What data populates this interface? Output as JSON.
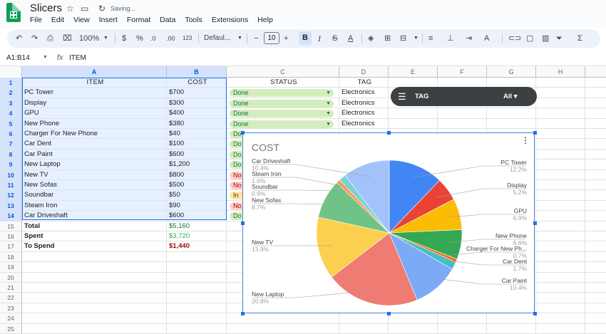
{
  "app": {
    "doc_title": "Slicers",
    "saving": "Saving...",
    "menu": [
      "File",
      "Edit",
      "View",
      "Insert",
      "Format",
      "Data",
      "Tools",
      "Extensions",
      "Help"
    ]
  },
  "toolbar": {
    "zoom": "100%",
    "currency": "$",
    "percent": "%",
    "dec_decrease": ".0",
    "dec_increase": ".00",
    "format_num": "123",
    "font": "Defaul...",
    "font_size": "10",
    "minus": "−",
    "plus": "+",
    "bold": "B",
    "italic": "I",
    "sum": "Σ"
  },
  "formula": {
    "name_box": "A1:B14",
    "fx": "fx",
    "value": "ITEM"
  },
  "columns": [
    "A",
    "B",
    "C",
    "D",
    "E",
    "F",
    "G",
    "H"
  ],
  "rows": [
    "1",
    "2",
    "3",
    "4",
    "5",
    "6",
    "7",
    "8",
    "9",
    "10",
    "11",
    "12",
    "13",
    "14",
    "15",
    "16",
    "17",
    "18",
    "19",
    "20",
    "21",
    "22",
    "23",
    "24",
    "25"
  ],
  "headers": {
    "item": "ITEM",
    "cost": "COST",
    "status": "STATUS",
    "tag": "TAG"
  },
  "table": [
    {
      "item": "PC Tower",
      "cost": "$700",
      "status": "Done",
      "s": "done",
      "tag": "Electronics"
    },
    {
      "item": "Display",
      "cost": "$300",
      "status": "Done",
      "s": "done",
      "tag": "Electronics"
    },
    {
      "item": "GPU",
      "cost": "$400",
      "status": "Done",
      "s": "done",
      "tag": "Electronics"
    },
    {
      "item": "New Phone",
      "cost": "$380",
      "status": "Done",
      "s": "done",
      "tag": "Electronics"
    },
    {
      "item": "Charger For New Phone",
      "cost": "$40",
      "status": "Do",
      "s": "done",
      "tag": ""
    },
    {
      "item": "Car Dent",
      "cost": "$100",
      "status": "Do",
      "s": "done",
      "tag": ""
    },
    {
      "item": "Car Paint",
      "cost": "$600",
      "status": "Do",
      "s": "done",
      "tag": ""
    },
    {
      "item": "New Laptop",
      "cost": "$1,200",
      "status": "Do",
      "s": "done",
      "tag": ""
    },
    {
      "item": "New TV",
      "cost": "$800",
      "status": "No",
      "s": "no",
      "tag": ""
    },
    {
      "item": "New Sofas",
      "cost": "$500",
      "status": "No",
      "s": "no",
      "tag": ""
    },
    {
      "item": "Soundbar",
      "cost": "$50",
      "status": "In",
      "s": "in",
      "tag": ""
    },
    {
      "item": "Steam Iron",
      "cost": "$90",
      "status": "No",
      "s": "no",
      "tag": ""
    },
    {
      "item": "Car Driveshaft",
      "cost": "$600",
      "status": "Do",
      "s": "done",
      "tag": ""
    }
  ],
  "summary": [
    {
      "label": "Total",
      "value": "$5,160",
      "color": "#137333"
    },
    {
      "label": "Spent",
      "value": "$3,720",
      "color": "#34a853"
    },
    {
      "label": "To Spend",
      "value": "$1,440",
      "color": "#a50e0e"
    }
  ],
  "slicer": {
    "column": "TAG",
    "value": "All ▾"
  },
  "chart_data": {
    "type": "pie",
    "title": "COST",
    "slices": [
      {
        "label": "PC Tower",
        "value": 700,
        "pct": "12.2%",
        "color": "#4285f4"
      },
      {
        "label": "Display",
        "value": 300,
        "pct": "5.2%",
        "color": "#ea4335"
      },
      {
        "label": "GPU",
        "value": 400,
        "pct": "6.9%",
        "color": "#fbbc04"
      },
      {
        "label": "New Phone",
        "value": 380,
        "pct": "6.6%",
        "color": "#34a853"
      },
      {
        "label": "Charger For New Ph...",
        "value": 40,
        "pct": "0.7%",
        "color": "#ff6d01"
      },
      {
        "label": "Car Dent",
        "value": 100,
        "pct": "1.7%",
        "color": "#46bdc6"
      },
      {
        "label": "Car Paint",
        "value": 600,
        "pct": "10.4%",
        "color": "#7baaf7"
      },
      {
        "label": "New Laptop",
        "value": 1200,
        "pct": "20.8%",
        "color": "#f07b72"
      },
      {
        "label": "New TV",
        "value": 800,
        "pct": "13.9%",
        "color": "#fcd04f"
      },
      {
        "label": "New Sofas",
        "value": 500,
        "pct": "8.7%",
        "color": "#71c287"
      },
      {
        "label": "Soundbar",
        "value": 50,
        "pct": "0.9%",
        "color": "#ff994d"
      },
      {
        "label": "Steam Iron",
        "value": 90,
        "pct": "1.6%",
        "color": "#7ed1d7"
      },
      {
        "label": "Car Driveshaft",
        "value": 600,
        "pct": "10.4%",
        "color": "#a1c2fa"
      }
    ]
  }
}
